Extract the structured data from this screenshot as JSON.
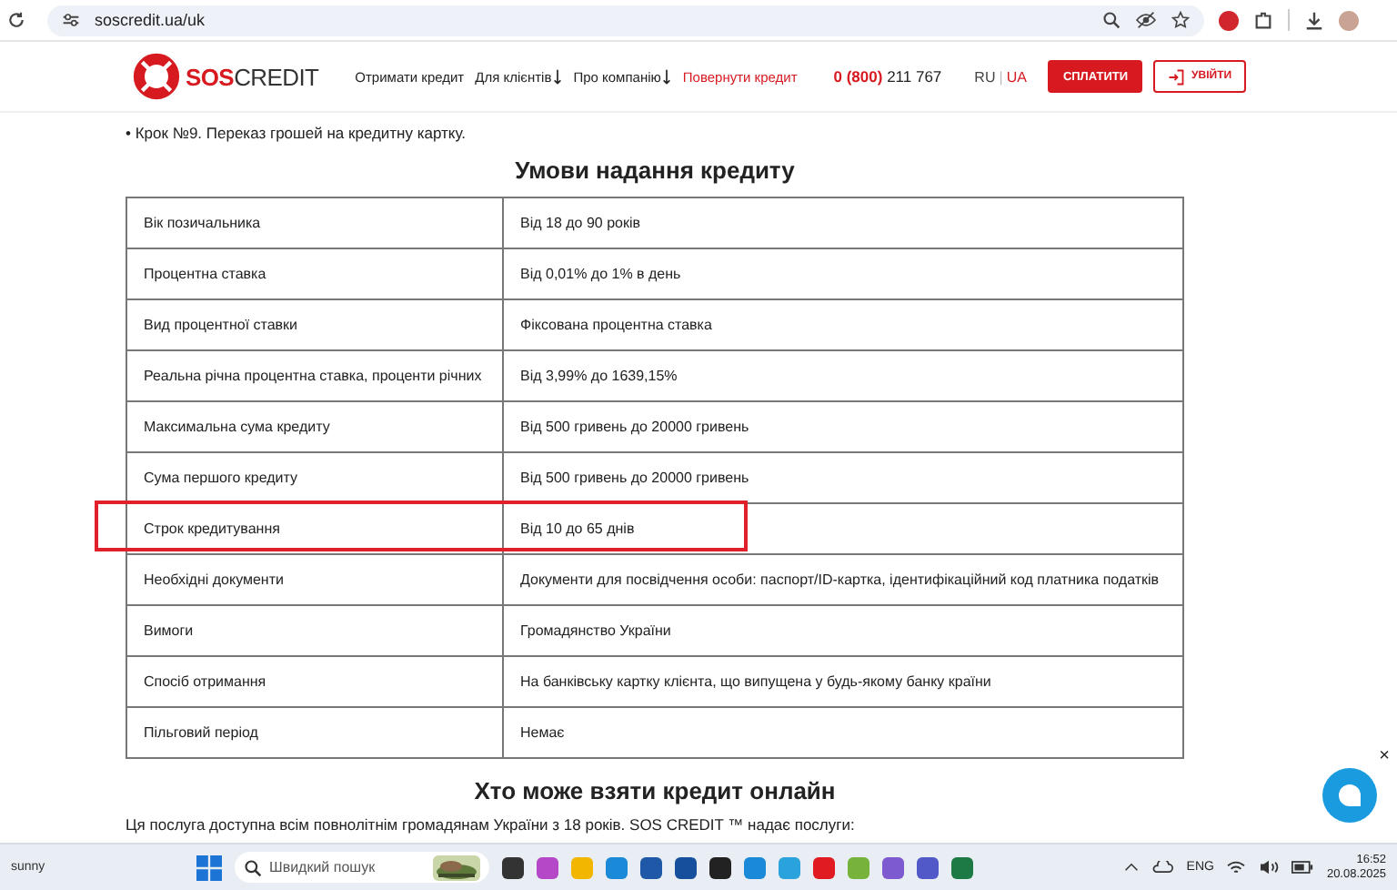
{
  "browser": {
    "url": "soscredit.ua/uk"
  },
  "header": {
    "logo": "SOS",
    "logo_rest": "CREDIT",
    "nav": [
      {
        "label": "Отримати кредит",
        "kind": "link"
      },
      {
        "label": "Для клієнтів",
        "kind": "dropdown"
      },
      {
        "label": "Про компанію",
        "kind": "dropdown"
      },
      {
        "label": "Повернути кредит",
        "kind": "accent"
      }
    ],
    "phone_code": "0 (800)",
    "phone_number": "211 767",
    "languages": [
      {
        "label": "RU",
        "selected": false
      },
      {
        "label": "UA",
        "selected": true
      }
    ],
    "language_separator": "|",
    "pay_button": "СПЛАТИТИ",
    "login_button": "УВІЙТИ"
  },
  "bullet": "• Крок №9. Переказ грошей на кредитну картку.",
  "table": {
    "title": "Умови надання кредиту",
    "rows": [
      {
        "label": "Вік позичальника",
        "value": "Від 18 до 90 років",
        "highlighted": false
      },
      {
        "label": "Процентна ставка",
        "value": "Від 0,01% до 1% в день",
        "highlighted": false
      },
      {
        "label": "Вид процентної ставки",
        "value": "Фіксована процентна ставка",
        "highlighted": false
      },
      {
        "label": "Реальна річна процентна ставка, проценти річних",
        "value": "Від 3,99% до 1639,15%",
        "highlighted": false
      },
      {
        "label": "Максимальна сума кредиту",
        "value": "Від 500 гривень до 20000 гривень",
        "highlighted": false
      },
      {
        "label": "Сума першого кредиту",
        "value": "Від 500 гривень до 20000 гривень",
        "highlighted": false
      },
      {
        "label": "Строк кредитування",
        "value": "Від 10 до 65 днів",
        "highlighted": true
      },
      {
        "label": "Необхідні документи",
        "value": "Документи для посвідчення особи: паспорт/ID-картка, ідентифікаційний код платника податків",
        "highlighted": false
      },
      {
        "label": "Вимоги",
        "value": "Громадянство України",
        "highlighted": false
      },
      {
        "label": "Спосіб отримання",
        "value": "На банківську картку клієнта, що випущена у будь-якому банку країни",
        "highlighted": false
      },
      {
        "label": "Пільговий період",
        "value": "Немає",
        "highlighted": false
      }
    ]
  },
  "section2": {
    "title": "Хто може взяти кредит онлайн",
    "text": "Ця послуга доступна всім повнолітнім громадянам України з 18 років. SOS CREDIT ™ надає послуги:"
  },
  "chat_close": "×",
  "taskbar": {
    "weather": "sunny",
    "search_placeholder": "Швидкий пошук",
    "language": "ENG",
    "time": "16:52",
    "date": "20.08.2025"
  }
}
